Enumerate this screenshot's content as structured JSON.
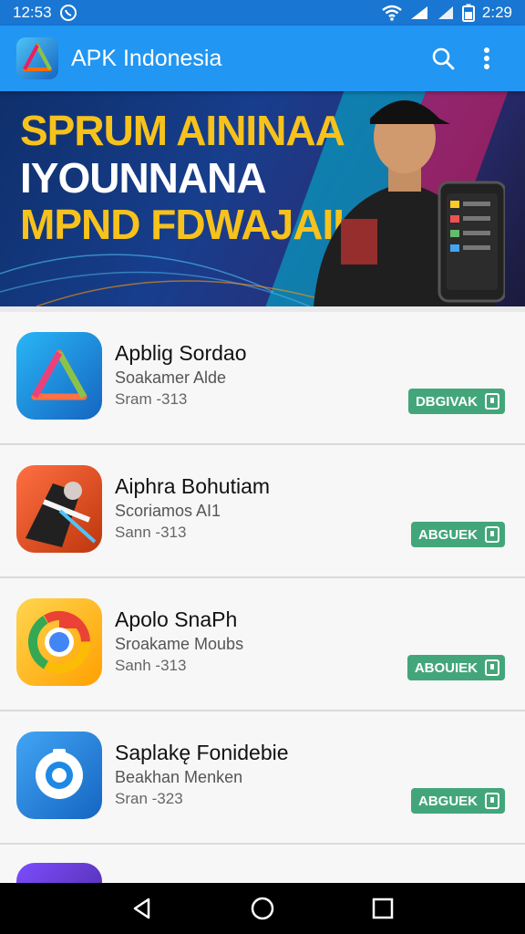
{
  "status_bar": {
    "time_left": "12:53",
    "time_right": "2:29",
    "icons": [
      "whatsapp-icon",
      "wifi-icon",
      "signal-icon",
      "battery-icon"
    ]
  },
  "app_bar": {
    "title": "APK Indonesia",
    "actions": [
      "search-icon",
      "more-vert-icon"
    ]
  },
  "banner": {
    "line1": "SPRUM AININAA",
    "line2": "IYOUNNANA",
    "line3": "MPND FDWAJAII"
  },
  "apps": [
    {
      "name": "Apblig Sordao",
      "developer": "Soakamer Alde",
      "size": "Sram -313",
      "button": "DBGIVAK",
      "icon": "apk-logo-icon"
    },
    {
      "name": "Aiphra Bohutiam",
      "developer": "Scoriamos AI1",
      "size": "Sann -313",
      "button": "ABGUEK",
      "icon": "action-game-icon"
    },
    {
      "name": "Apolo SnaPh",
      "developer": "Sroakame Moubs",
      "size": "Sanh -313",
      "button": "ABOUIEK",
      "icon": "chrome-icon"
    },
    {
      "name": "Saplakę Fonidebie",
      "developer": "Beakhan Menken",
      "size": "Sran -323",
      "button": "ABGUEK",
      "icon": "camera-icon"
    }
  ],
  "nav": [
    "back-icon",
    "home-icon",
    "recents-icon"
  ],
  "colors": {
    "status_bar": "#1976d2",
    "app_bar": "#2196f3",
    "download_button": "#43a67a",
    "banner_accent": "#f7c21b"
  }
}
